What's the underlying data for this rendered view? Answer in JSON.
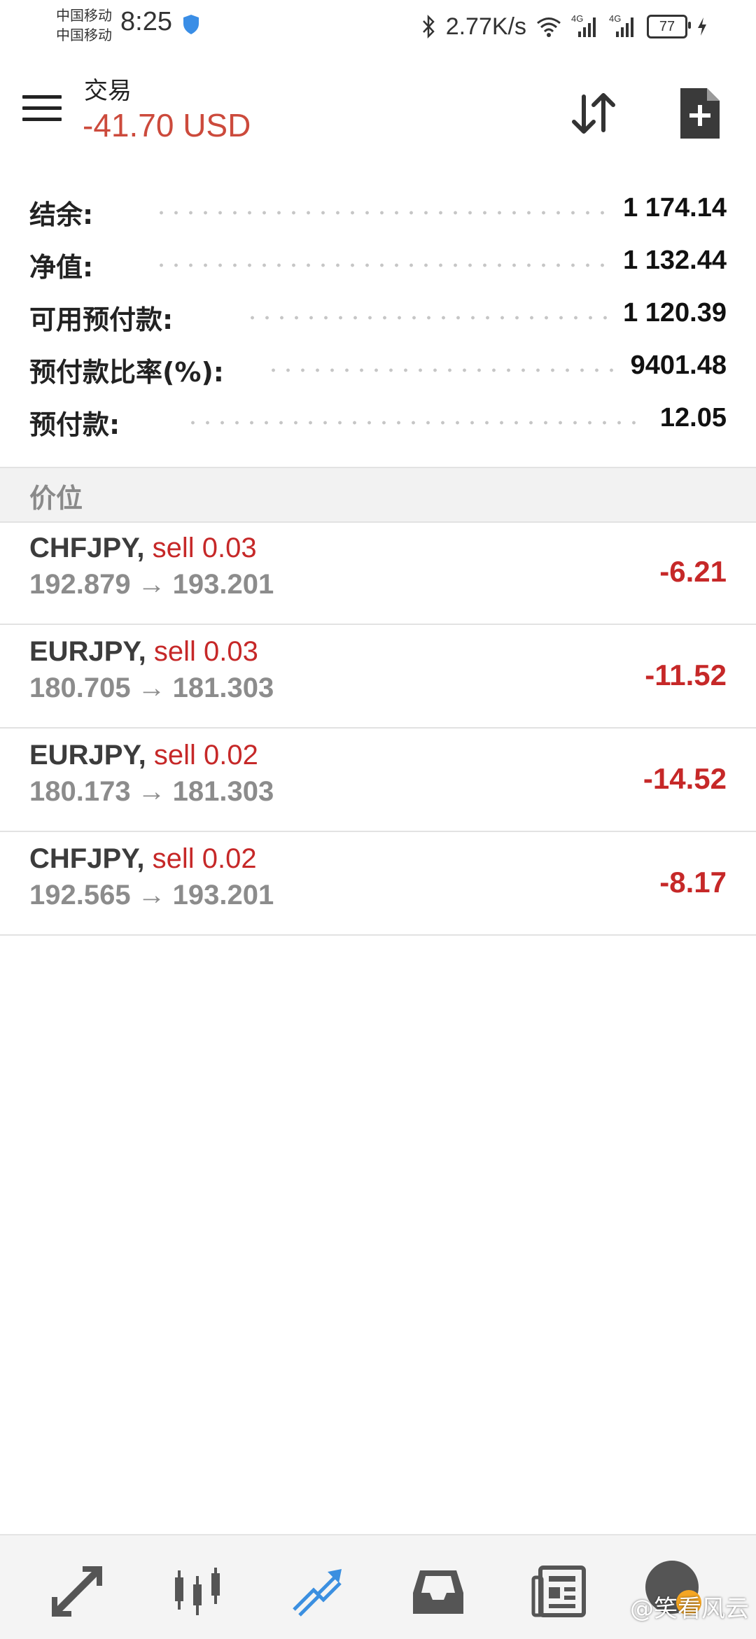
{
  "status_bar": {
    "carrier1": "中国移动",
    "carrier2": "中国移动",
    "time": "8:25",
    "net_speed": "2.77K/s",
    "net_type_1": "4G",
    "net_type_2": "4G",
    "battery": "77"
  },
  "header": {
    "title": "交易",
    "subtitle": "-41.70 USD"
  },
  "summary": [
    {
      "label": "结余:",
      "value": "1 174.14"
    },
    {
      "label": "净值:",
      "value": "1 132.44"
    },
    {
      "label": "可用预付款:",
      "value": "1 120.39"
    },
    {
      "label": "预付款比率(%):",
      "value": "9401.48"
    },
    {
      "label": "预付款:",
      "value": "12.05"
    }
  ],
  "section_title": "价位",
  "positions": [
    {
      "symbol": "CHFJPY,",
      "type": "sell 0.03",
      "open": "192.879",
      "arrow": "→",
      "current": "193.201",
      "profit": "-6.21"
    },
    {
      "symbol": "EURJPY,",
      "type": "sell 0.03",
      "open": "180.705",
      "arrow": "→",
      "current": "181.303",
      "profit": "-11.52"
    },
    {
      "symbol": "EURJPY,",
      "type": "sell 0.02",
      "open": "180.173",
      "arrow": "→",
      "current": "181.303",
      "profit": "-14.52"
    },
    {
      "symbol": "CHFJPY,",
      "type": "sell 0.02",
      "open": "192.565",
      "arrow": "→",
      "current": "193.201",
      "profit": "-8.17"
    }
  ],
  "bottom_nav": {
    "icons": [
      "quotes-icon",
      "chart-candles-icon",
      "trade-icon",
      "history-inbox-icon",
      "news-icon"
    ],
    "active_color": "#3b8fe0",
    "inactive_color": "#555555"
  },
  "watermark": "@笑看风云",
  "colors": {
    "loss": "#c62828",
    "subtitle": "#cc4a3c"
  }
}
